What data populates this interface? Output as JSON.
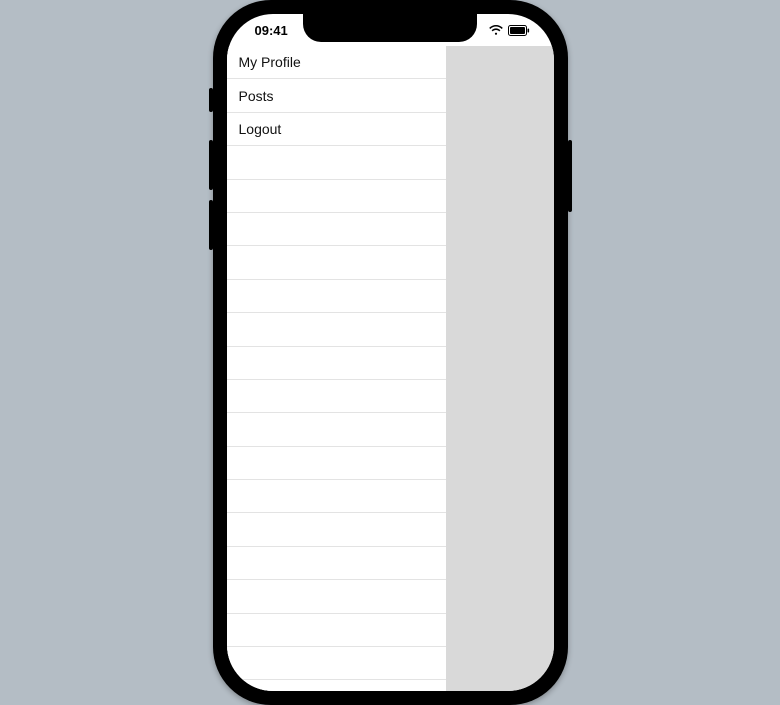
{
  "status": {
    "time": "09:41"
  },
  "drawer": {
    "items": [
      {
        "label": "My Profile"
      },
      {
        "label": "Posts"
      },
      {
        "label": "Logout"
      }
    ],
    "empty_row_count": 16
  }
}
